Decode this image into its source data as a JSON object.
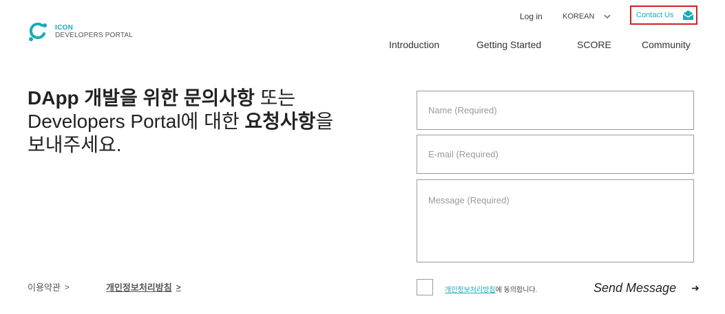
{
  "logo": {
    "brand": "ICON",
    "sub": "DEVELOPERS PORTAL",
    "icon": "icon-logo-mark"
  },
  "utility": {
    "login": "Log in",
    "language": "KOREAN",
    "contact": "Contact Us",
    "contact_icon": "envelope-icon",
    "accent": "#1aaaba",
    "highlight": "#d01e24"
  },
  "nav": {
    "items": [
      "Introduction",
      "Getting Started",
      "SCORE",
      "Community"
    ]
  },
  "headline": {
    "part1_bold": "DApp 개발을 위한 문의사항",
    "part1_rest": " 또는",
    "part2_light": "Developers Portal에 대한 ",
    "part2_bold": "요청사항",
    "part2_rest": "을",
    "part3": "보내주세요."
  },
  "form": {
    "name_placeholder": "Name (Required)",
    "email_placeholder": "E-mail (Required)",
    "message_placeholder": "Message (Required)",
    "agree_link": "개인정보처리방침",
    "agree_rest": "에 동의합니다.",
    "send": "Send Message",
    "send_icon": "arrow-right-icon"
  },
  "footer": {
    "terms": "이용약관",
    "privacy": "개인정보처리방침",
    "arrow": ">"
  }
}
